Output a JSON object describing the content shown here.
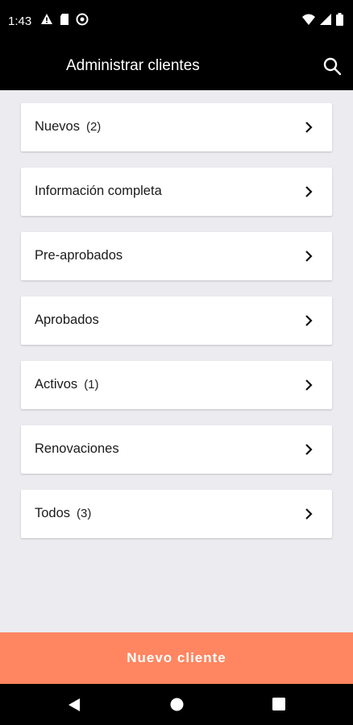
{
  "status_bar": {
    "time": "1:43",
    "left_icons": [
      "warning-icon",
      "sd-card-icon",
      "vpn-icon"
    ],
    "right_icons": [
      "wifi-icon",
      "signal-icon",
      "battery-icon"
    ]
  },
  "header": {
    "title": "Administrar clientes",
    "search_icon": "search-icon"
  },
  "categories": [
    {
      "label": "Nuevos",
      "count": "(2)"
    },
    {
      "label": "Información completa",
      "count": ""
    },
    {
      "label": "Pre-aprobados",
      "count": ""
    },
    {
      "label": "Aprobados",
      "count": ""
    },
    {
      "label": "Activos",
      "count": "(1)"
    },
    {
      "label": "Renovaciones",
      "count": ""
    },
    {
      "label": "Todos",
      "count": "(3)"
    }
  ],
  "primary_action": {
    "label": "Nuevo cliente"
  },
  "colors": {
    "background": "#ebebf0",
    "header": "#000000",
    "cta": "#ff8660"
  }
}
